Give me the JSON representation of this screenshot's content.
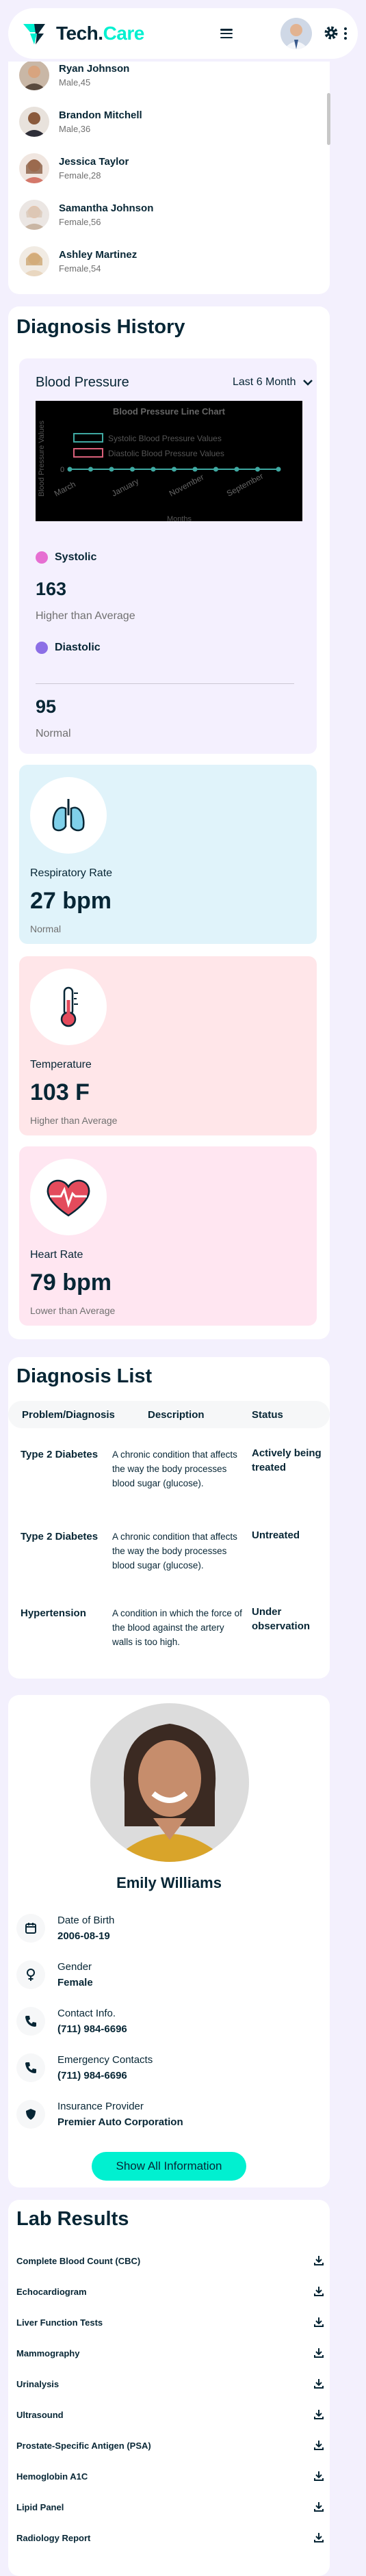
{
  "header": {
    "logo_main": "Tech.",
    "logo_accent": "Care"
  },
  "patients": [
    {
      "name": "Ryan Johnson",
      "meta": "Male,45"
    },
    {
      "name": "Brandon Mitchell",
      "meta": "Male,36"
    },
    {
      "name": "Jessica Taylor",
      "meta": "Female,28"
    },
    {
      "name": "Samantha Johnson",
      "meta": "Female,56"
    },
    {
      "name": "Ashley Martinez",
      "meta": "Female,54"
    }
  ],
  "diagnosis_history": {
    "title": "Diagnosis History",
    "bp_title": "Blood Pressure",
    "range_select": "Last 6 Month",
    "systolic": {
      "label": "Systolic",
      "value": "163",
      "note": "Higher than Average",
      "color": "#e66fd2"
    },
    "diastolic": {
      "label": "Diastolic",
      "value": "95",
      "note": "Normal",
      "color": "#8c6fe6"
    }
  },
  "chart_data": {
    "type": "line",
    "title": "Blood Pressure Line Chart",
    "x": [
      "March",
      "January",
      "November",
      "September"
    ],
    "xlabel": "Months",
    "ylabel": "Blood Pressure Values",
    "series": [
      {
        "name": "Systolic Blood Pressure Values",
        "values": [
          0,
          0,
          0,
          0,
          0,
          0,
          0,
          0,
          0,
          0,
          0
        ]
      },
      {
        "name": "Diastolic Blood Pressure Values",
        "values": []
      }
    ],
    "y_tick": "0",
    "legend": "top"
  },
  "vitals": [
    {
      "label": "Respiratory Rate",
      "value": "27 bpm",
      "note": "Normal",
      "color": "#e0f3fa",
      "icon": "lungs-icon"
    },
    {
      "label": "Temperature",
      "value": "103 F",
      "note": "Higher than Average",
      "color": "#ffe6e9",
      "icon": "thermometer-icon"
    },
    {
      "label": "Heart Rate",
      "value": "79 bpm",
      "note": "Lower than Average",
      "color": "#ffe6f1",
      "icon": "heart-icon"
    }
  ],
  "diagnosis_list": {
    "title": "Diagnosis List",
    "headers": [
      "Problem/Diagnosis",
      "Description",
      "Status"
    ],
    "rows": [
      {
        "name": "Type 2 Diabetes",
        "desc": "A chronic condition that affects the way the body processes blood sugar (glucose).",
        "status": "Actively being treated"
      },
      {
        "name": "Type 2 Diabetes",
        "desc": "A chronic condition that affects the way the body processes blood sugar (glucose).",
        "status": "Untreated"
      },
      {
        "name": "Hypertension",
        "desc": "A condition in which the force of the blood against the artery walls is too high.",
        "status": "Under observation"
      }
    ]
  },
  "profile": {
    "name": "Emily Williams",
    "fields": [
      {
        "label": "Date of Birth",
        "value": "2006-08-19",
        "icon": "calendar-icon"
      },
      {
        "label": "Gender",
        "value": "Female",
        "icon": "female-icon"
      },
      {
        "label": "Contact Info.",
        "value": "(711) 984-6696",
        "icon": "phone-icon"
      },
      {
        "label": "Emergency Contacts",
        "value": "(711) 984-6696",
        "icon": "phone-icon"
      },
      {
        "label": "Insurance Provider",
        "value": "Premier Auto Corporation",
        "icon": "shield-icon"
      }
    ],
    "button": "Show All Information"
  },
  "lab_results": {
    "title": "Lab Results",
    "items": [
      "Complete Blood Count (CBC)",
      "Echocardiogram",
      "Liver Function Tests",
      "Mammography",
      "Urinalysis",
      "Ultrasound",
      "Prostate-Specific Antigen (PSA)",
      "Hemoglobin A1C",
      "Lipid Panel",
      "Radiology Report"
    ]
  }
}
